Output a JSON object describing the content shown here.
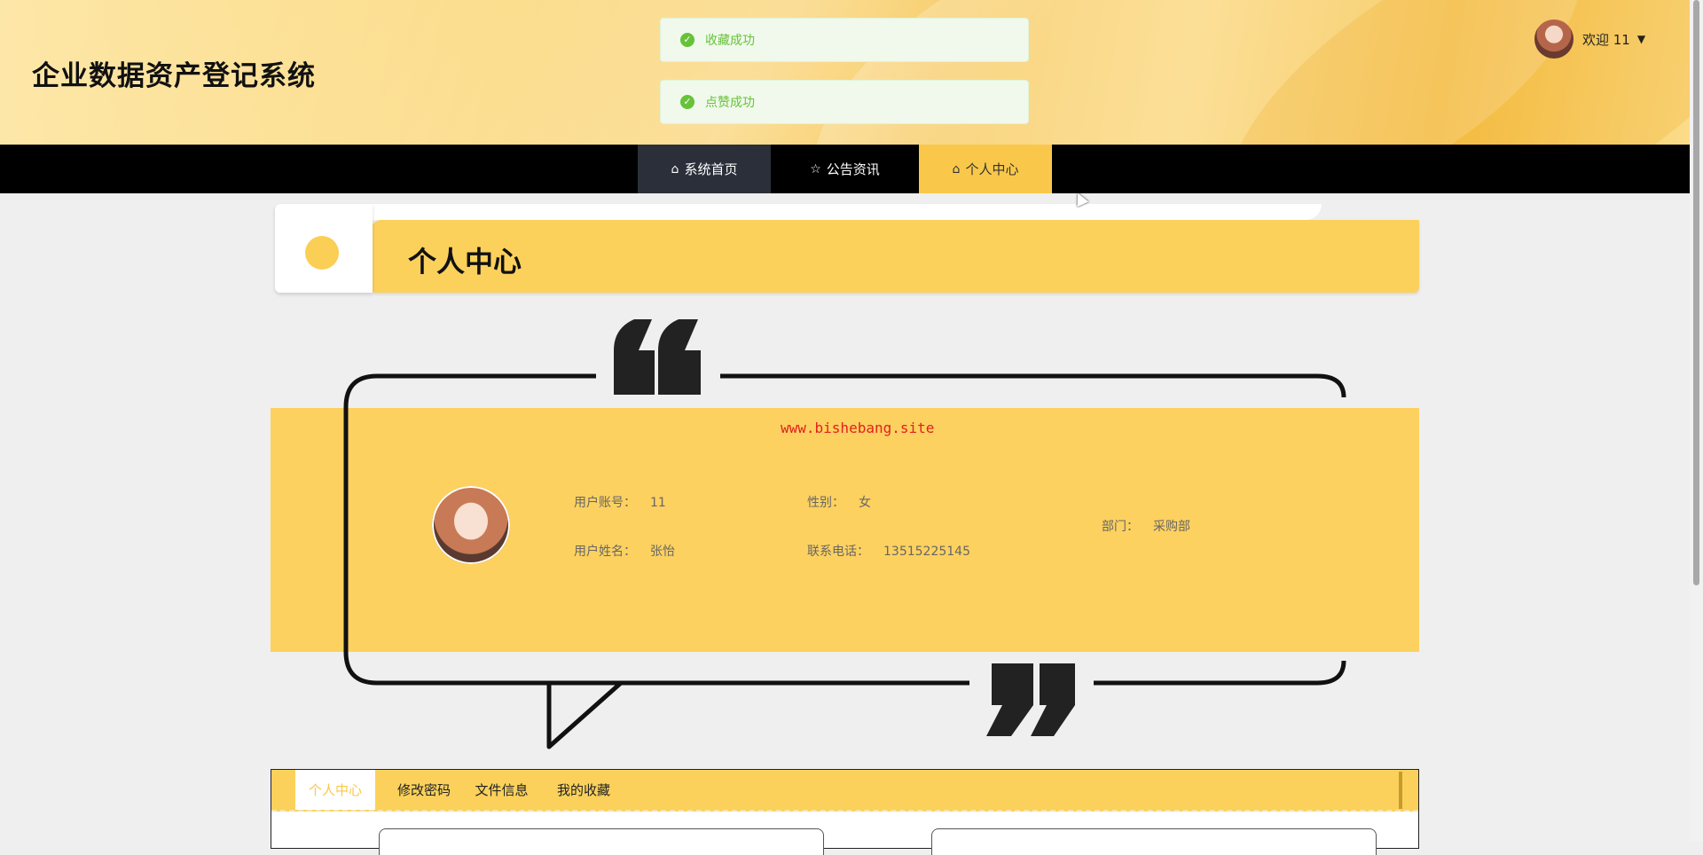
{
  "header": {
    "site_title": "企业数据资产登记系统",
    "user_greeting": "欢迎 11"
  },
  "toasts": [
    {
      "text": "收藏成功",
      "type": "success"
    },
    {
      "text": "点赞成功",
      "type": "success"
    }
  ],
  "nav": {
    "items": [
      {
        "label": "系统首页",
        "icon": "home-icon"
      },
      {
        "label": "公告资讯",
        "icon": "star-icon"
      },
      {
        "label": "个人中心",
        "icon": "home-icon",
        "active": true
      }
    ]
  },
  "page": {
    "title": "个人中心",
    "watermark": "www.bishebang.site"
  },
  "profile": {
    "account_label": "用户账号：",
    "account_value": "11",
    "gender_label": "性别：",
    "gender_value": "女",
    "name_label": "用户姓名：",
    "name_value": "张怡",
    "phone_label": "联系电话：",
    "phone_value": "13515225145",
    "dept_label": "部门：",
    "dept_value": "采购部"
  },
  "tabs": [
    {
      "label": "个人中心",
      "active": true
    },
    {
      "label": "修改密码"
    },
    {
      "label": "文件信息"
    },
    {
      "label": "我的收藏"
    }
  ],
  "colors": {
    "accent": "#fbd15c",
    "success": "#67c23a",
    "nav_bg": "#000000",
    "watermark": "#e12020"
  }
}
